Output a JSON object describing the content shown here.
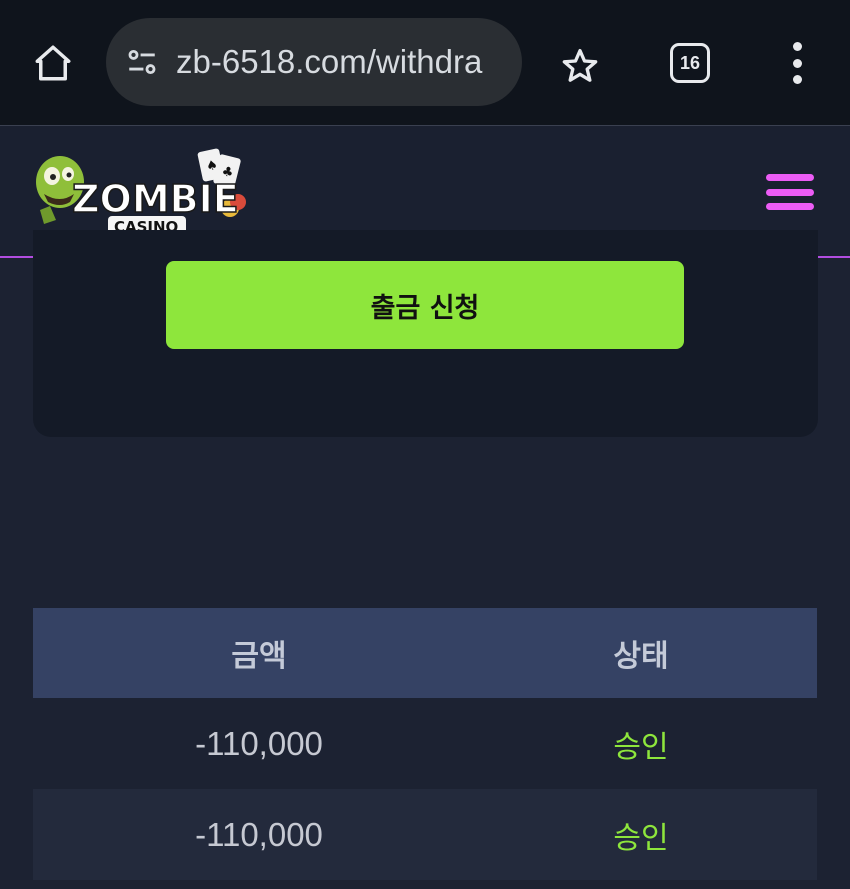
{
  "browser": {
    "url": "zb-6518.com/withdra",
    "tab_count": "16"
  },
  "header": {
    "logo_text": "ZOMBIE",
    "logo_subtext": "CASINO"
  },
  "withdraw": {
    "submit_label": "출금 신청"
  },
  "table": {
    "headers": [
      "금액",
      "상태"
    ],
    "rows": [
      {
        "amount": "-110,000",
        "status": "승인"
      },
      {
        "amount": "-110,000",
        "status": "승인"
      }
    ]
  },
  "colors": {
    "accent_green": "#8ee63c",
    "menu_pink": "#ec5cf5",
    "table_header": "#354264"
  }
}
